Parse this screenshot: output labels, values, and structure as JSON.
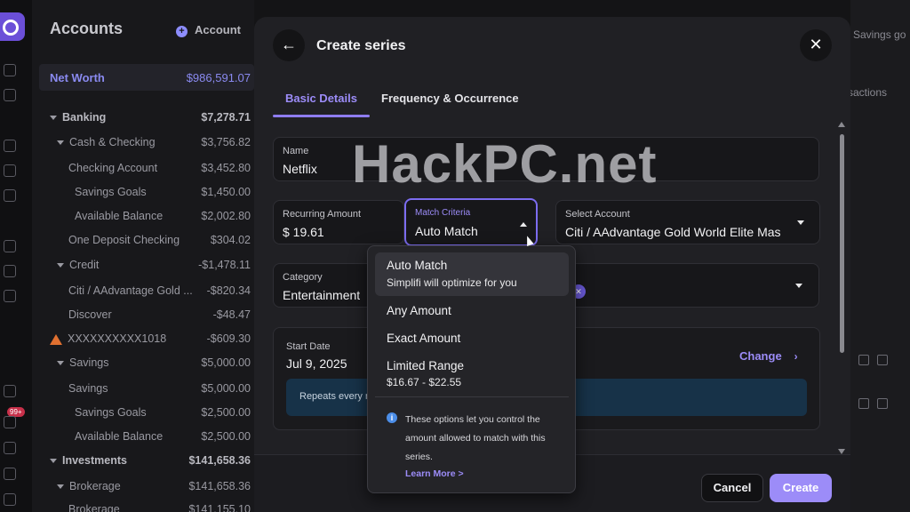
{
  "sidebar": {
    "title": "Accounts",
    "add_label": "Account",
    "net_worth": {
      "label": "Net Worth",
      "value": "$986,591.07"
    },
    "badge": "99+",
    "rows": [
      {
        "label": "Banking",
        "value": "$7,278.71"
      },
      {
        "label": "Cash & Checking",
        "value": "$3,756.82"
      },
      {
        "label": "Checking Account",
        "value": "$3,452.80"
      },
      {
        "label": "Savings Goals",
        "value": "$1,450.00"
      },
      {
        "label": "Available Balance",
        "value": "$2,002.80"
      },
      {
        "label": "One Deposit Checking",
        "value": "$304.02"
      },
      {
        "label": "Credit",
        "value": "-$1,478.11"
      },
      {
        "label": "Citi / AAdvantage Gold ...",
        "value": "-$820.34"
      },
      {
        "label": "Discover",
        "value": "-$48.47"
      },
      {
        "label": "XXXXXXXXXX1018",
        "value": "-$609.30"
      },
      {
        "label": "Savings",
        "value": "$5,000.00"
      },
      {
        "label": "Savings",
        "value": "$5,000.00"
      },
      {
        "label": "Savings Goals",
        "value": "$2,500.00"
      },
      {
        "label": "Available Balance",
        "value": "$2,500.00"
      },
      {
        "label": "Investments",
        "value": "$141,658.36"
      },
      {
        "label": "Brokerage",
        "value": "$141,658.36"
      },
      {
        "label": "Brokerage",
        "value": "$141,155.10"
      }
    ]
  },
  "background_right": {
    "text1": "Savings go",
    "text2": "sactions"
  },
  "modal": {
    "title": "Create series",
    "tabs": [
      "Basic Details",
      "Frequency & Occurrence"
    ],
    "name_field": {
      "label": "Name",
      "value": "Netflix"
    },
    "amount_field": {
      "label": "Recurring Amount",
      "value": "$ 19.61"
    },
    "match_field": {
      "label": "Match Criteria",
      "value": "Auto Match"
    },
    "account_field": {
      "label": "Select Account",
      "value": "Citi / AAdvantage Gold World Elite Mas"
    },
    "category_field": {
      "label": "Category",
      "value": "Entertainment"
    },
    "start": {
      "label": "Start Date",
      "value": "Jul 9, 2025",
      "change": "Change",
      "repeats": "Repeats every n"
    },
    "cancel": "Cancel",
    "create": "Create"
  },
  "dropdown": {
    "options": [
      {
        "title": "Auto Match",
        "sub": "Simplifi will optimize for you"
      },
      {
        "title": "Any Amount",
        "sub": ""
      },
      {
        "title": "Exact Amount",
        "sub": ""
      },
      {
        "title": "Limited Range",
        "sub": "$16.67 - $22.55"
      }
    ],
    "info": "These options let you control the amount allowed to match with this series.",
    "learn_more": "Learn More >"
  },
  "watermark": "HackPC.net",
  "colors": {
    "accent": "#9c8cf8",
    "background": "#141416",
    "modal": "#202024",
    "info_banner": "#173248"
  }
}
